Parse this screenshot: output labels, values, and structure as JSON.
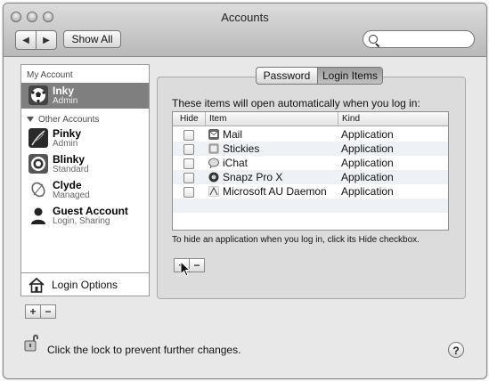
{
  "window": {
    "title": "Accounts"
  },
  "toolbar": {
    "back_icon": "left-arrow-icon",
    "forward_icon": "right-arrow-icon",
    "show_all_label": "Show All",
    "search_value": "",
    "search_icon": "magnifier-icon"
  },
  "sidebar": {
    "my_account_header": "My Account",
    "my_account": {
      "name": "Inky",
      "role": "Admin"
    },
    "other_accounts_header": "Other Accounts",
    "others": [
      {
        "name": "Pinky",
        "role": "Admin"
      },
      {
        "name": "Blinky",
        "role": "Standard"
      },
      {
        "name": "Clyde",
        "role": "Managed"
      },
      {
        "name": "Guest Account",
        "role": "Login, Sharing"
      }
    ],
    "login_options_label": "Login Options",
    "add_label": "+",
    "remove_label": "−"
  },
  "tabs": {
    "password": "Password",
    "login_items": "Login Items",
    "selected": "Login Items"
  },
  "login_items": {
    "intro": "These items will open automatically when you log in:",
    "columns": {
      "hide": "Hide",
      "item": "Item",
      "kind": "Kind"
    },
    "rows": [
      {
        "name": "Mail",
        "kind": "Application",
        "hide": false,
        "icon": "mail-app-icon"
      },
      {
        "name": "Stickies",
        "kind": "Application",
        "hide": false,
        "icon": "stickies-app-icon"
      },
      {
        "name": "iChat",
        "kind": "Application",
        "hide": false,
        "icon": "ichat-app-icon"
      },
      {
        "name": "Snapz Pro X",
        "kind": "Application",
        "hide": false,
        "icon": "snapz-pro-x-app-icon"
      },
      {
        "name": "Microsoft AU Daemon",
        "kind": "Application",
        "hide": false,
        "icon": "microsoft-au-daemon-app-icon"
      }
    ],
    "hint": "To hide an application when you log in, click its Hide checkbox.",
    "add_label": "+",
    "remove_label": "−"
  },
  "footer": {
    "lock_label": "Click the lock to prevent further changes.",
    "help_label": "?"
  },
  "colors": {
    "selection": "#7f7f7f",
    "alt_row": "#eef1f6",
    "window_bg": "#e8e8e8"
  }
}
